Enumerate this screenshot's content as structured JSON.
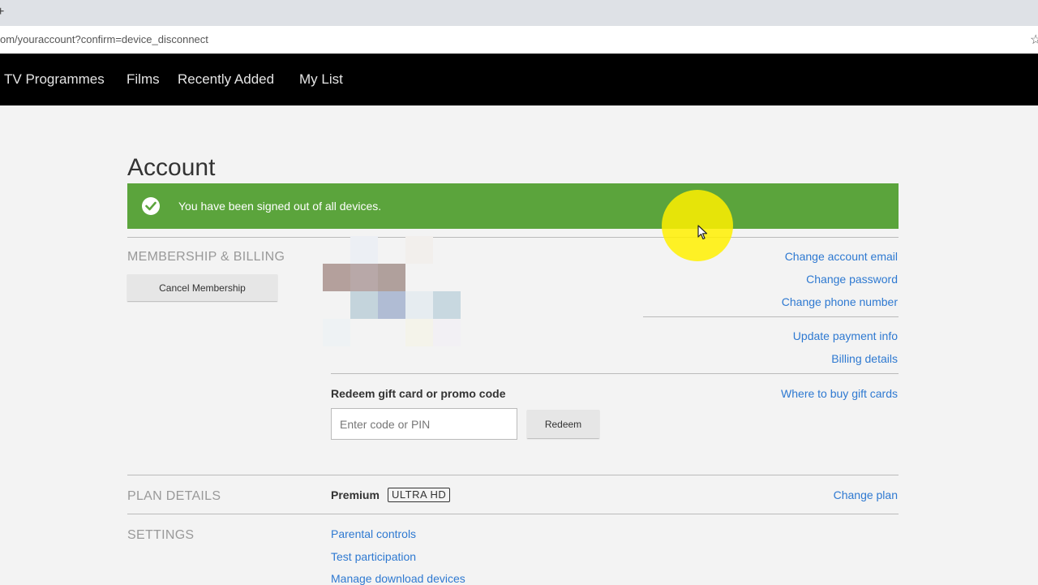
{
  "browser": {
    "new_tab_glyph": "+",
    "url": "om/youraccount?confirm=device_disconnect",
    "bookmark_icon": "star-icon"
  },
  "nav": {
    "items": [
      {
        "label": "TV Programmes"
      },
      {
        "label": "Films"
      },
      {
        "label": "Recently Added"
      },
      {
        "label": "My List"
      }
    ]
  },
  "page": {
    "title": "Account"
  },
  "banner": {
    "message": "You have been signed out of all devices.",
    "icon": "check-circle-icon",
    "color": "#5ba43c"
  },
  "membership": {
    "label": "MEMBERSHIP & BILLING",
    "cancel_button": "Cancel Membership",
    "links": {
      "change_email": "Change account email",
      "change_password": "Change password",
      "change_phone": "Change phone number",
      "update_payment": "Update payment info",
      "billing_details": "Billing details",
      "where_to_buy": "Where to buy gift cards"
    },
    "redeem": {
      "label": "Redeem gift card or promo code",
      "placeholder": "Enter code or PIN",
      "button": "Redeem"
    }
  },
  "plan": {
    "label": "PLAN DETAILS",
    "name": "Premium",
    "badge": "ULTRA HD",
    "change_link": "Change plan"
  },
  "settings": {
    "label": "SETTINGS",
    "links": [
      {
        "label": "Parental controls"
      },
      {
        "label": "Test participation"
      },
      {
        "label": "Manage download devices"
      }
    ]
  },
  "colors": {
    "link": "#2e79d1",
    "nav_bg": "#000000",
    "page_bg": "#f3f3f3",
    "cursor_highlight": "#fff000"
  }
}
